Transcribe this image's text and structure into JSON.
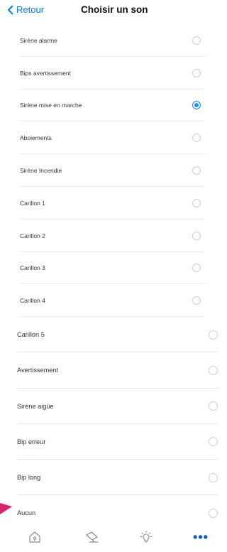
{
  "header": {
    "back_label": "Retour",
    "title": "Choisir un son"
  },
  "sounds": [
    {
      "label": "Sirène alarme",
      "selected": false
    },
    {
      "label": "Bips avertissement",
      "selected": false
    },
    {
      "label": "Sirène mise en marche",
      "selected": true
    },
    {
      "label": "Aboiements",
      "selected": false
    },
    {
      "label": "Sirène Incendie",
      "selected": false
    },
    {
      "label": "Carillon 1",
      "selected": false
    },
    {
      "label": "Carillon 2",
      "selected": false
    },
    {
      "label": "Carillon 3",
      "selected": false
    },
    {
      "label": "Carillon 4",
      "selected": false
    },
    {
      "label": "Carillon 5",
      "selected": false
    },
    {
      "label": "Avertissement",
      "selected": false
    },
    {
      "label": "Sirène aigüe",
      "selected": false
    },
    {
      "label": "Bip erreur",
      "selected": false
    },
    {
      "label": "Bip long",
      "selected": false
    },
    {
      "label": "Aucun",
      "selected": false
    }
  ],
  "tabbar": {
    "tabs": [
      "home-icon",
      "camera-icon",
      "lightbulb-icon",
      "more-icon"
    ],
    "active": "more-icon"
  },
  "colors": {
    "accent": "#0a7ae0",
    "radio_checked": "#1e8ff0",
    "pointer": "#d6246e"
  }
}
